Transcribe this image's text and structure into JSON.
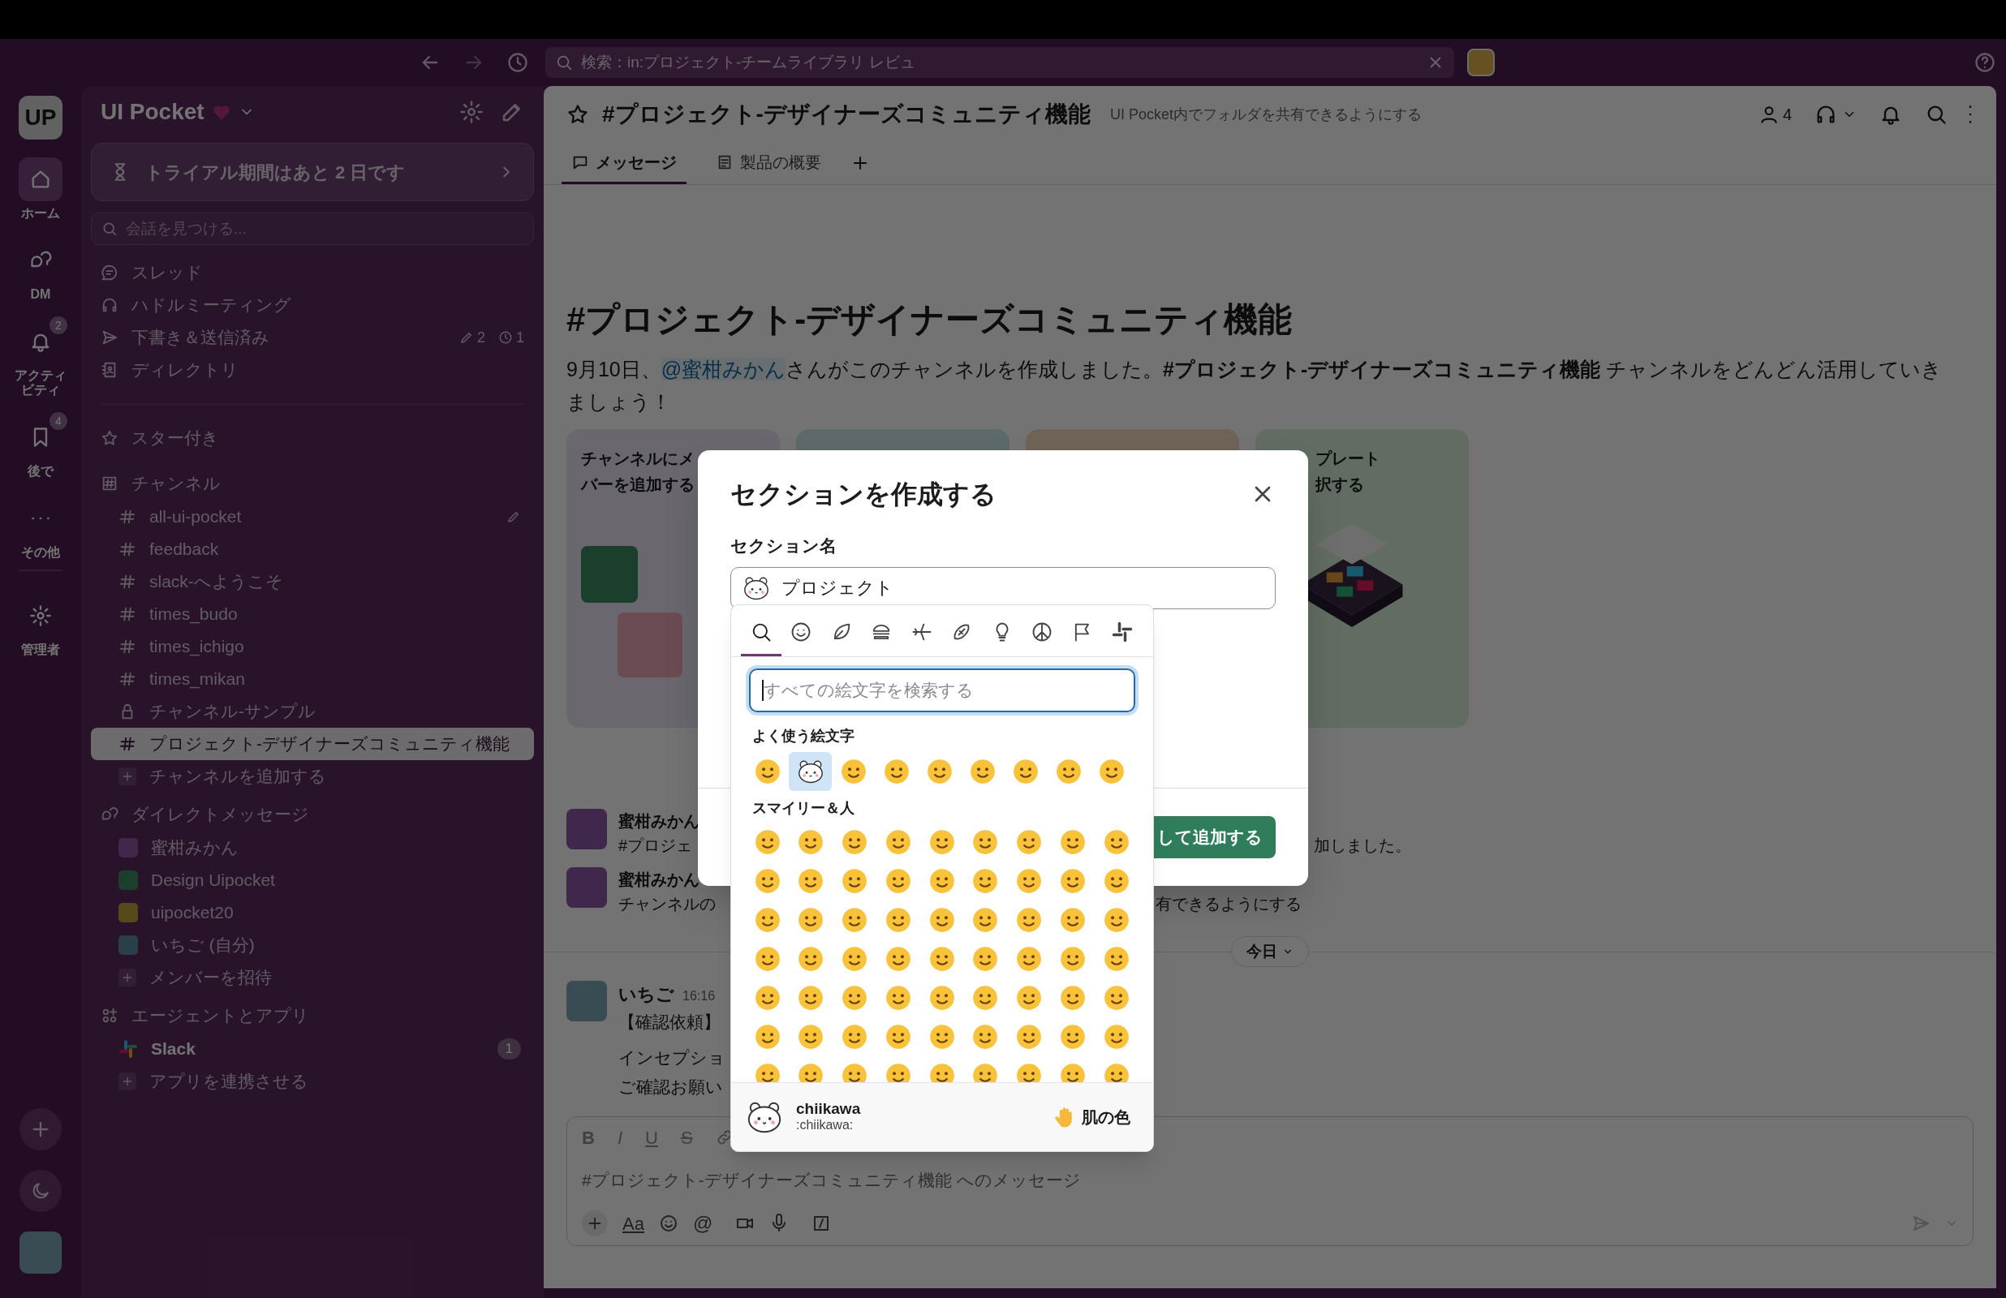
{
  "title_bar": {
    "search_value": "検索：in:プロジェクト-チームライブラリ レビュ"
  },
  "rail": {
    "workspace_initials": "UP",
    "items": [
      {
        "kind": "home",
        "label": "ホーム",
        "selected": true
      },
      {
        "kind": "dm",
        "label": "DM",
        "selected": false
      },
      {
        "kind": "activity",
        "label": "アクティビティ",
        "selected": false,
        "badge": "2"
      },
      {
        "kind": "later",
        "label": "後で",
        "selected": false,
        "badge": "4"
      },
      {
        "kind": "more",
        "label": "その他",
        "selected": false
      },
      {
        "kind": "admin",
        "label": "管理者",
        "selected": false
      }
    ]
  },
  "sidebar": {
    "workspace": "UI Pocket",
    "trial_banner": "トライアル期間はあと 2 日です",
    "find_placeholder": "会話を見つける...",
    "nav": [
      {
        "kind": "threads",
        "label": "スレッド"
      },
      {
        "kind": "huddles",
        "label": "ハドルミーティング"
      },
      {
        "kind": "drafts",
        "label": "下書き＆送信済み",
        "draft_count": "2",
        "scheduled_count": "1"
      },
      {
        "kind": "directory",
        "label": "ディレクトリ"
      }
    ],
    "sections": [
      {
        "kind": "starred",
        "title": "スター付き"
      },
      {
        "kind": "channels",
        "title": "チャンネル",
        "items": [
          {
            "kind": "public",
            "name": "all-ui-pocket",
            "selected": false,
            "edit_icon": true
          },
          {
            "kind": "public",
            "name": "feedback",
            "selected": false,
            "edit_icon": false
          },
          {
            "kind": "public",
            "name": "slack-へようこそ",
            "selected": false,
            "edit_icon": false
          },
          {
            "kind": "public",
            "name": "times_budo",
            "selected": false,
            "edit_icon": false
          },
          {
            "kind": "public",
            "name": "times_ichigo",
            "selected": false,
            "edit_icon": false
          },
          {
            "kind": "public",
            "name": "times_mikan",
            "selected": false,
            "edit_icon": false
          },
          {
            "kind": "private",
            "name": "チャンネル-サンプル",
            "selected": false,
            "edit_icon": false
          },
          {
            "kind": "public",
            "name": "プロジェクト-デザイナーズコミュニティ機能",
            "selected": true,
            "edit_icon": false
          },
          {
            "kind": "add",
            "name": "チャンネルを追加する",
            "selected": false,
            "edit_icon": false
          }
        ]
      },
      {
        "kind": "dms",
        "title": "ダイレクトメッセージ",
        "items": [
          {
            "kind": "person",
            "name": "蜜柑みかん"
          },
          {
            "kind": "person",
            "name": "Design Uipocket"
          },
          {
            "kind": "person",
            "name": "uipocket20"
          },
          {
            "kind": "photo",
            "name": "いちご (自分)"
          },
          {
            "kind": "add",
            "name": "メンバーを招待"
          }
        ]
      },
      {
        "kind": "apps",
        "title": "エージェントとアプリ",
        "items": [
          {
            "kind": "app",
            "name": "Slack",
            "badge": "1"
          },
          {
            "kind": "add",
            "name": "アプリを連携させる"
          }
        ]
      }
    ]
  },
  "channel_header": {
    "title": "#プロジェクト-デザイナーズコミュニティ機能",
    "topic": "UI Pocket内でフォルダを共有できるようにする",
    "member_count": "4",
    "tabs": [
      {
        "kind": "messages",
        "label": "メッセージ",
        "selected": true
      },
      {
        "kind": "canvas",
        "label": "製品の概要",
        "selected": false
      }
    ]
  },
  "intro": {
    "title": "#プロジェクト-デザイナーズコミュニティ機能",
    "before": "9月10日、",
    "mention": "@蜜柑みかん",
    "after": "さんがこのチャンネルを作成しました。**#プロジェクト-デザイナーズコミュニティ機能** チャンネルをどんどん活用していきましょう！",
    "cards": [
      {
        "kind": "people",
        "lines": [
          "チャンネルにメ",
          "バーを追加する"
        ]
      },
      {
        "kind": "plain"
      },
      {
        "kind": "plain"
      },
      {
        "kind": "template",
        "lines": [
          "プレート",
          "択する"
        ]
      }
    ]
  },
  "messages": [
    {
      "author": "蜜柑みかん",
      "text": "#プロジェ",
      "text_right": "加しました。"
    },
    {
      "author": "蜜柑みかん",
      "text": "チャンネルの",
      "text_right": "有できるようにする"
    }
  ],
  "date_divider": "今日",
  "latest_message": {
    "author": "いちご",
    "time": "16:16",
    "lines": [
      "【確認依頼】",
      "インセプショ",
      "ご確認お願い"
    ]
  },
  "composer": {
    "format_buttons": [
      "B",
      "I",
      "U",
      "S"
    ],
    "placeholder": "#プロジェクト-デザイナーズコミュニティ機能 へのメッセージ",
    "text_button": "Aa",
    "mention_button": "@"
  },
  "modal": {
    "title": "セクションを作成する",
    "field_label": "セクション名",
    "field_value": "プロジェクト",
    "button": "して追加する"
  },
  "emoji_picker": {
    "categories": [
      {
        "kind": "search",
        "selected": true
      },
      {
        "kind": "smileys",
        "selected": false
      },
      {
        "kind": "nature",
        "selected": false
      },
      {
        "kind": "food",
        "selected": false
      },
      {
        "kind": "travel",
        "selected": false
      },
      {
        "kind": "activity",
        "selected": false
      },
      {
        "kind": "objects",
        "selected": false
      },
      {
        "kind": "symbols",
        "selected": false
      },
      {
        "kind": "flags",
        "selected": false
      },
      {
        "kind": "custom",
        "selected": false
      }
    ],
    "search_placeholder": "すべての絵文字を検索する",
    "frequent_title": "よく使う絵文字",
    "frequent": [
      {
        "selected": false
      },
      {
        "selected": true
      },
      {
        "selected": false
      },
      {
        "selected": false
      },
      {
        "selected": false
      },
      {
        "selected": false
      },
      {
        "selected": false
      },
      {
        "selected": false
      },
      {
        "selected": false
      }
    ],
    "smileys_title": "スマイリー＆人",
    "preview_name": "chiikawa",
    "preview_code": ":chiikawa:",
    "skin_tone": "肌の色"
  }
}
